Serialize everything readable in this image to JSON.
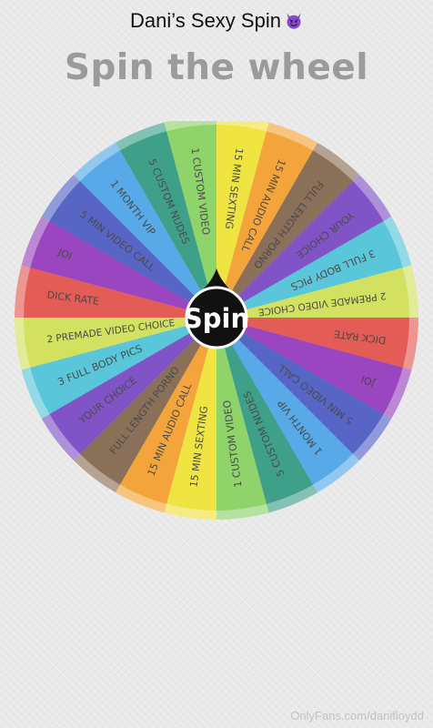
{
  "header": {
    "title": "Dani’s Sexy Spin",
    "title_emoji": "smiling-face-with-horns-icon"
  },
  "main": {
    "heading": "Spin the wheel"
  },
  "wheel": {
    "spin_label": "Spin",
    "segments": [
      {
        "label": "15 MIN SEXTING",
        "color": "#f0e442"
      },
      {
        "label": "15 MIN AUDIO CALL",
        "color": "#f3a53b"
      },
      {
        "label": "FULL LENGTH PORNO",
        "color": "#8b7059"
      },
      {
        "label": "YOUR CHOICE",
        "color": "#8054c6"
      },
      {
        "label": "3 FULL BODY PICS",
        "color": "#5ac6d9"
      },
      {
        "label": "2 PREMADE VIDEO CHOICE",
        "color": "#d2e160"
      },
      {
        "label": "DICK RATE",
        "color": "#e35d56"
      },
      {
        "label": "JOI",
        "color": "#9a46c0"
      },
      {
        "label": "5 MIN VIDEO CALL",
        "color": "#5765c4"
      },
      {
        "label": "1 MONTH VIP",
        "color": "#57a9e8"
      },
      {
        "label": "5 CUSTOM NUDES",
        "color": "#3fa08a"
      },
      {
        "label": "1 CUSTOM VIDEO",
        "color": "#8fd36b"
      },
      {
        "label": "15 MIN SEXTING",
        "color": "#f0e442"
      },
      {
        "label": "15 MIN AUDIO CALL",
        "color": "#f3a53b"
      },
      {
        "label": "FULL LENGTH PORNO",
        "color": "#8b7059"
      },
      {
        "label": "YOUR CHOICE",
        "color": "#8054c6"
      },
      {
        "label": "3 FULL BODY PICS",
        "color": "#5ac6d9"
      },
      {
        "label": "2 PREMADE VIDEO CHOICE",
        "color": "#d2e160"
      },
      {
        "label": "DICK RATE",
        "color": "#e35d56"
      },
      {
        "label": "JOI",
        "color": "#9a46c0"
      },
      {
        "label": "5 MIN VIDEO CALL",
        "color": "#5765c4"
      },
      {
        "label": "1 MONTH VIP",
        "color": "#57a9e8"
      },
      {
        "label": "5 CUSTOM NUDES",
        "color": "#3fa08a"
      },
      {
        "label": "1 CUSTOM VIDEO",
        "color": "#8fd36b"
      }
    ]
  },
  "footer": {
    "watermark": "OnlyFans.com/danifloydd"
  },
  "colors": {
    "background": "#e9e9e9",
    "heading": "#9b9b9b",
    "hub": "#111111",
    "segment_text": "#4a4a4a"
  }
}
